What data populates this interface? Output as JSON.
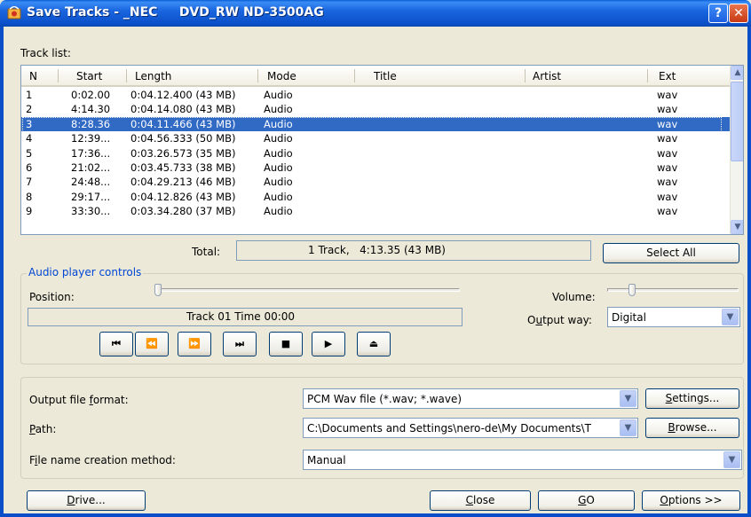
{
  "window": {
    "title": "Save Tracks - _NEC     DVD_RW ND-3500AG",
    "help": "?",
    "close": "✕"
  },
  "track_list": {
    "label": "Track list:",
    "columns": [
      "N",
      "Start",
      "Length",
      "Mode",
      "Title",
      "Artist",
      "Ext"
    ],
    "rows": [
      {
        "n": "1",
        "start": "0:02.00",
        "length": "0:04.12.400 (43 MB)",
        "mode": "Audio",
        "title": "",
        "artist": "",
        "ext": "wav",
        "selected": false
      },
      {
        "n": "2",
        "start": "4:14.30",
        "length": "0:04.14.080 (43 MB)",
        "mode": "Audio",
        "title": "",
        "artist": "",
        "ext": "wav",
        "selected": false
      },
      {
        "n": "3",
        "start": "8:28.36",
        "length": "0:04.11.466 (43 MB)",
        "mode": "Audio",
        "title": "",
        "artist": "",
        "ext": "wav",
        "selected": true
      },
      {
        "n": "4",
        "start": "12:39...",
        "length": "0:04.56.333 (50 MB)",
        "mode": "Audio",
        "title": "",
        "artist": "",
        "ext": "wav",
        "selected": false
      },
      {
        "n": "5",
        "start": "17:36...",
        "length": "0:03.26.573 (35 MB)",
        "mode": "Audio",
        "title": "",
        "artist": "",
        "ext": "wav",
        "selected": false
      },
      {
        "n": "6",
        "start": "21:02...",
        "length": "0:03.45.733 (38 MB)",
        "mode": "Audio",
        "title": "",
        "artist": "",
        "ext": "wav",
        "selected": false
      },
      {
        "n": "7",
        "start": "24:48...",
        "length": "0:04.29.213 (46 MB)",
        "mode": "Audio",
        "title": "",
        "artist": "",
        "ext": "wav",
        "selected": false
      },
      {
        "n": "8",
        "start": "29:17...",
        "length": "0:04.12.826 (43 MB)",
        "mode": "Audio",
        "title": "",
        "artist": "",
        "ext": "wav",
        "selected": false
      },
      {
        "n": "9",
        "start": "33:30...",
        "length": "0:03.34.280 (37 MB)",
        "mode": "Audio",
        "title": "",
        "artist": "",
        "ext": "wav",
        "selected": false
      }
    ]
  },
  "total": {
    "label": "Total:",
    "value": "1 Track,   4:13.35 (43 MB)"
  },
  "select_all": "Select All",
  "player": {
    "legend": "Audio player controls",
    "position_label": "Position:",
    "position_fraction": 0,
    "volume_label": "Volume:",
    "volume_fraction": 0.17,
    "status": "Track 01 Time 00:00",
    "output_way_label": "Output way:",
    "output_way_value": "Digital",
    "buttons": [
      {
        "name": "previous-track-button",
        "glyph": "⏮"
      },
      {
        "name": "rewind-button",
        "glyph": "⏪"
      },
      {
        "name": "fast-forward-button",
        "glyph": "⏩"
      },
      {
        "name": "next-track-button",
        "glyph": "⏭"
      },
      {
        "name": "stop-button",
        "glyph": "■"
      },
      {
        "name": "play-button",
        "glyph": "▶"
      },
      {
        "name": "eject-button",
        "glyph": "⏏"
      }
    ]
  },
  "output": {
    "format_label": "Output file format:",
    "format_value": "PCM Wav file (*.wav; *.wave)",
    "settings": "Settings...",
    "path_label": "Path:",
    "path_value": "C:\\Documents and Settings\\nero-de\\My Documents\\T",
    "browse": "Browse...",
    "method_label": "File name creation method:",
    "method_value": "Manual"
  },
  "footer": {
    "drive": "Drive...",
    "close": "Close",
    "go": "GO",
    "options": "Options >>"
  }
}
